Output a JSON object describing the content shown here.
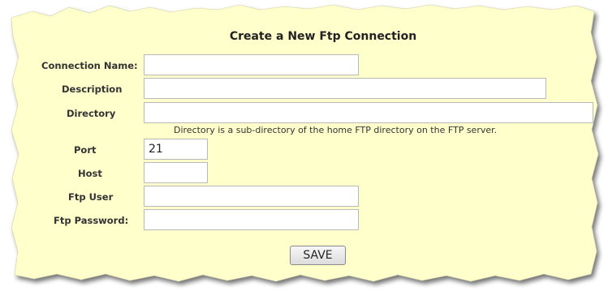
{
  "colors": {
    "panel": "#ffffcc"
  },
  "form": {
    "title": "Create a New Ftp Connection",
    "fields": {
      "connection_name": {
        "label": "Connection Name:",
        "value": ""
      },
      "description": {
        "label": "Description",
        "value": ""
      },
      "directory": {
        "label": "Directory",
        "value": "",
        "hint": "Directory is a sub-directory of the home FTP directory on the FTP server."
      },
      "port": {
        "label": "Port",
        "value": "21"
      },
      "host": {
        "label": "Host",
        "value": ""
      },
      "ftp_user": {
        "label": "Ftp User",
        "value": ""
      },
      "ftp_password": {
        "label": "Ftp Password:",
        "value": ""
      }
    },
    "save_label": "SAVE"
  }
}
